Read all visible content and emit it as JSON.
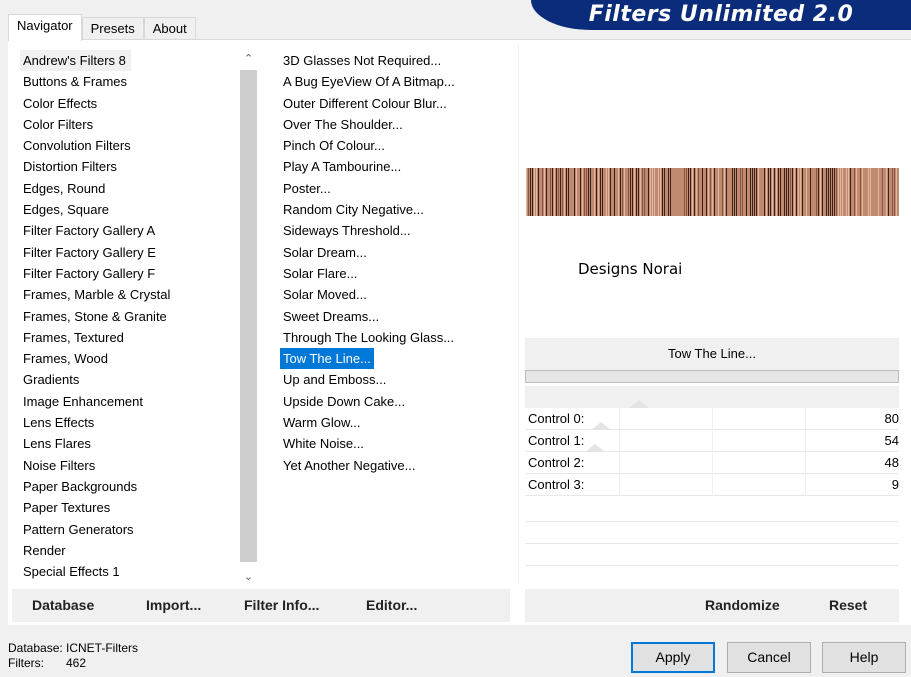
{
  "tabs": [
    "Navigator",
    "Presets",
    "About"
  ],
  "banner_title": "Filters Unlimited 2.0",
  "categories": [
    "Andrew's Filters 8",
    "Buttons & Frames",
    "Color Effects",
    "Color Filters",
    "Convolution Filters",
    "Distortion Filters",
    "Edges, Round",
    "Edges, Square",
    "Filter Factory Gallery A",
    "Filter Factory Gallery E",
    "Filter Factory Gallery F",
    "Frames, Marble & Crystal",
    "Frames, Stone & Granite",
    "Frames, Textured",
    "Frames, Wood",
    "Gradients",
    "Image Enhancement",
    "Lens Effects",
    "Lens Flares",
    "Noise Filters",
    "Paper Backgrounds",
    "Paper Textures",
    "Pattern Generators",
    "Render",
    "Special Effects 1"
  ],
  "selected_category": 0,
  "filters": [
    "3D Glasses Not Required...",
    "A Bug EyeView Of A Bitmap...",
    "Outer Different Colour Blur...",
    "Over The Shoulder...",
    "Pinch Of Colour...",
    "Play A Tambourine...",
    "Poster...",
    "Random City Negative...",
    "Sideways Threshold...",
    "Solar Dream...",
    "Solar Flare...",
    "Solar Moved...",
    "Sweet Dreams...",
    "Through The Looking Glass...",
    "Tow The Line...",
    "Up and Emboss...",
    "Upside Down Cake...",
    "Warm Glow...",
    "White Noise...",
    "Yet Another Negative..."
  ],
  "selected_filter": 14,
  "preview_caption": "Designs Norai",
  "current_filter_name": "Tow The Line...",
  "controls": [
    {
      "label": "Control 0:",
      "value": 80
    },
    {
      "label": "Control 1:",
      "value": 54
    },
    {
      "label": "Control 2:",
      "value": 48
    },
    {
      "label": "Control 3:",
      "value": 9
    }
  ],
  "left_buttons": {
    "database": "Database",
    "import": "Import...",
    "filter_info": "Filter Info...",
    "editor": "Editor..."
  },
  "right_buttons": {
    "randomize": "Randomize",
    "reset": "Reset"
  },
  "status": {
    "database_label": "Database:",
    "database_value": "ICNET-Filters",
    "filters_label": "Filters:",
    "filters_value": "462"
  },
  "dialog_buttons": {
    "apply": "Apply",
    "cancel": "Cancel",
    "help": "Help"
  },
  "colors": {
    "accent": "#0078d7",
    "banner": "#0a2c7a",
    "preview": "#c08a70"
  },
  "icons": {
    "scroll_up": "chevron-up-icon",
    "scroll_down": "chevron-down-icon"
  }
}
